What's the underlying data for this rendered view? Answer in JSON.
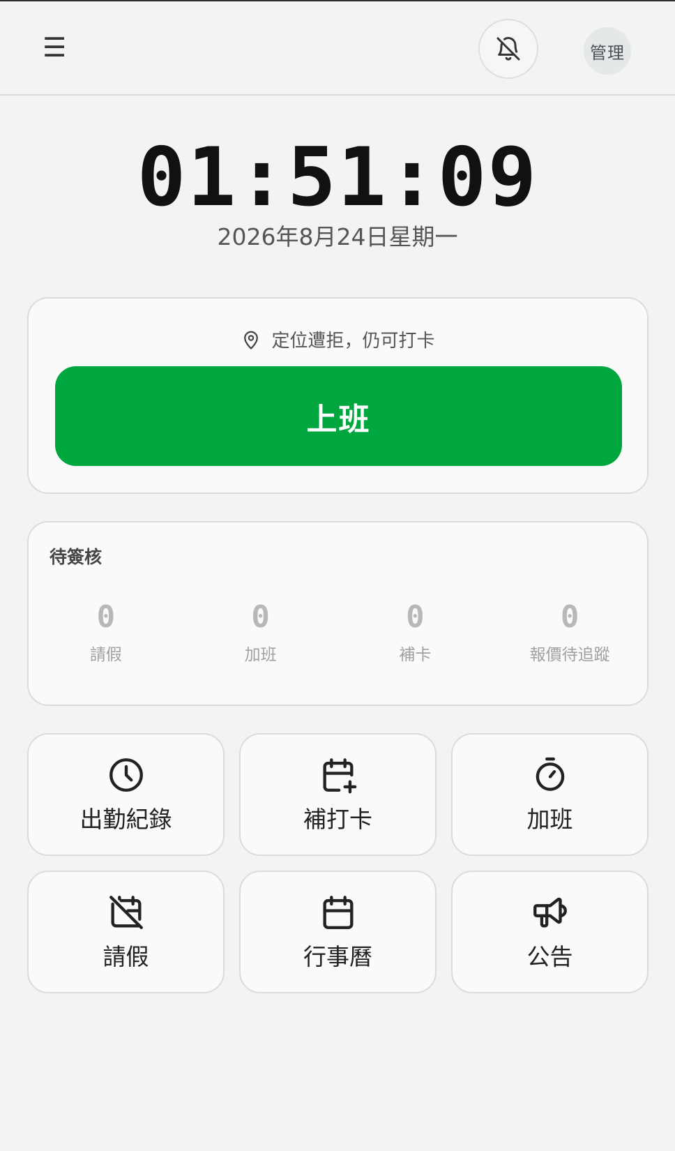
{
  "header": {
    "menu_icon": "☰",
    "avatar_text": "管理"
  },
  "clock": {
    "time": "01:51:09",
    "date": "2026年8月24日星期一"
  },
  "punch": {
    "location_status": "定位遭拒，仍可打卡",
    "clock_in_label": "上班",
    "button_color": "#00a63e"
  },
  "pending": {
    "title": "待簽核",
    "items": [
      {
        "count": "0",
        "label": "請假"
      },
      {
        "count": "0",
        "label": "加班"
      },
      {
        "count": "0",
        "label": "補卡"
      },
      {
        "count": "0",
        "label": "報價待追蹤"
      }
    ]
  },
  "tiles": [
    {
      "label": "出勤紀錄",
      "icon": "clock-icon"
    },
    {
      "label": "補打卡",
      "icon": "calendar-plus-icon"
    },
    {
      "label": "加班",
      "icon": "stopwatch-icon"
    },
    {
      "label": "請假",
      "icon": "calendar-off-icon"
    },
    {
      "label": "行事曆",
      "icon": "calendar-icon"
    },
    {
      "label": "公告",
      "icon": "megaphone-icon"
    }
  ]
}
